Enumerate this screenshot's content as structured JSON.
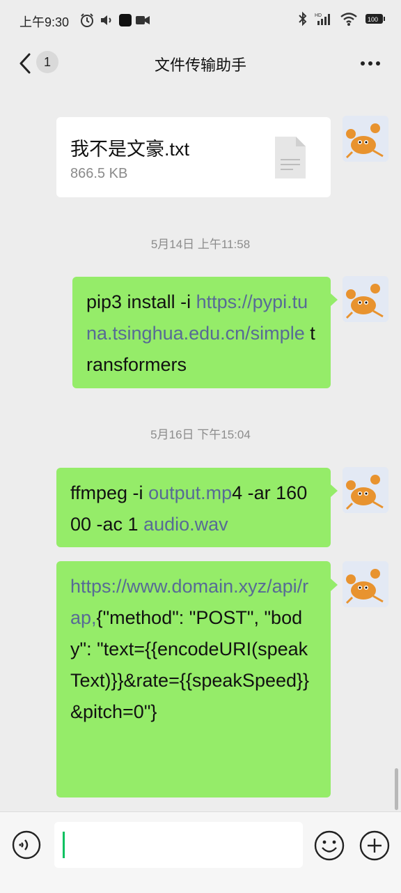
{
  "status_bar": {
    "time": "上午9:30",
    "battery": "100"
  },
  "header": {
    "unread_count": "1",
    "title": "文件传输助手"
  },
  "messages": [
    {
      "type": "file",
      "file_name": "我不是文豪.txt",
      "file_size": "866.5 KB"
    },
    {
      "type": "timestamp",
      "text": "5月14日 上午11:58"
    },
    {
      "type": "text",
      "parts": {
        "p1": "pip3 install -i ",
        "link1": "https://pypi.tuna.tsinghua.edu.cn/simple",
        "p2": " transformers"
      }
    },
    {
      "type": "timestamp",
      "text": "5月16日 下午15:04"
    },
    {
      "type": "text",
      "parts": {
        "p1": "ffmpeg -i ",
        "link1": "output.mp",
        "p2": "4 -ar 16000 -ac 1 ",
        "link2": "audio.wav"
      }
    },
    {
      "type": "text",
      "parts": {
        "link1": "https://www.domain.xyz/api/rap,",
        "p1": "{\"method\": \"POST\", \"body\": \"text={{encodeURI(speakText)}}&rate={{speakSpeed}}&pitch=0\"}"
      }
    }
  ],
  "input": {
    "value": ""
  },
  "colors": {
    "bubble_green": "#95ec69",
    "link": "#576b95",
    "background": "#ededed"
  }
}
